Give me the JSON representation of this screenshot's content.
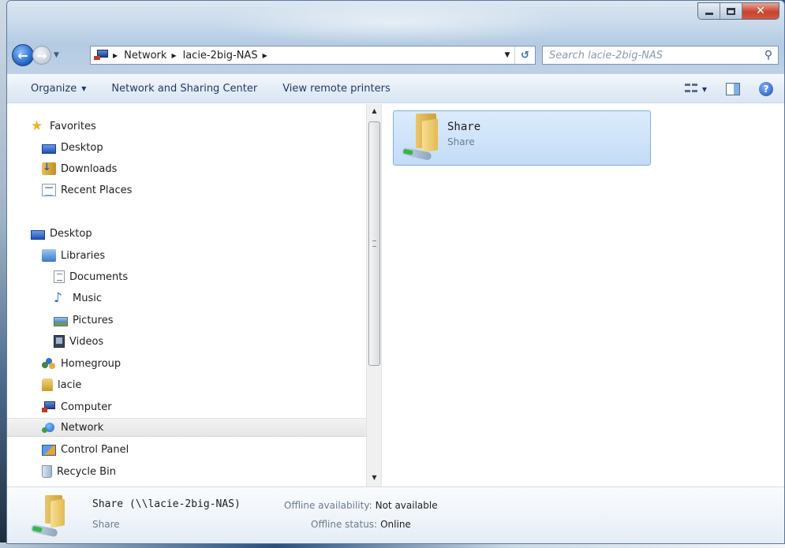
{
  "window": {
    "caption": {
      "minimize": "—",
      "maximize": "□",
      "close": "✕"
    }
  },
  "address_bar": {
    "crumbs": [
      "Network",
      "lacie-2big-NAS"
    ],
    "search_placeholder": "Search lacie-2big-NAS"
  },
  "command_bar": {
    "items": [
      "Organize",
      "Network and Sharing Center",
      "View remote printers"
    ]
  },
  "nav_pane": {
    "favorites": {
      "label": "Favorites",
      "items": [
        "Desktop",
        "Downloads",
        "Recent Places"
      ]
    },
    "desktop": {
      "label": "Desktop"
    },
    "libraries": {
      "label": "Libraries",
      "items": [
        "Documents",
        "Music",
        "Pictures",
        "Videos"
      ]
    },
    "others": [
      "Homegroup",
      "lacie",
      "Computer",
      "Network",
      "Control Panel",
      "Recycle Bin"
    ],
    "selected": "Network"
  },
  "content": {
    "items": [
      {
        "name": "Share",
        "subtitle": "Share"
      }
    ]
  },
  "details": {
    "title": "Share (\\\\lacie-2big-NAS)",
    "subtitle": "Share",
    "offline_availability_label": "Offline availability:",
    "offline_availability_value": "Not available",
    "offline_status_label": "Offline status:",
    "offline_status_value": "Online"
  },
  "icons": {
    "back": "back-arrow-icon",
    "forward": "forward-arrow-icon",
    "refresh": "refresh-icon",
    "search": "search-icon",
    "help": "help-icon",
    "view": "change-view-icon",
    "preview": "preview-pane-icon"
  }
}
